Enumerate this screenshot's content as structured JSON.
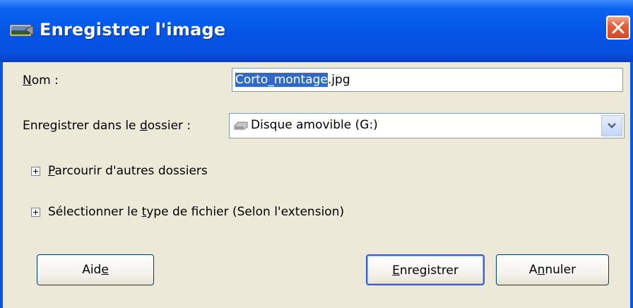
{
  "window": {
    "title": "Enregistrer l'image"
  },
  "name": {
    "label_first": "N",
    "label_rest": "om :",
    "value_selected": "Corto_montage",
    "value_rest": ".jpg"
  },
  "folder": {
    "label_prefix": "Enregistrer dans le ",
    "label_accel": "d",
    "label_suffix": "ossier :",
    "value": "Disque amovible (G:)",
    "icon": "removable-drive-icon"
  },
  "browse": {
    "label_accel": "P",
    "label_rest": "arcourir d'autres dossiers"
  },
  "filetype": {
    "label_prefix": "Sélectionner le ",
    "label_accel": "t",
    "label_suffix": "ype de fichier (Selon l'extension)"
  },
  "buttons": {
    "help_prefix": "Aid",
    "help_accel": "e",
    "save_accel": "E",
    "save_rest": "nregistrer",
    "cancel_prefix": "A",
    "cancel_accel": "n",
    "cancel_rest": "nuler"
  },
  "colors": {
    "titlebar": "#0454e6",
    "selection": "#316ac5",
    "dialog_bg": "#ece9d8",
    "close": "#d24a25"
  }
}
